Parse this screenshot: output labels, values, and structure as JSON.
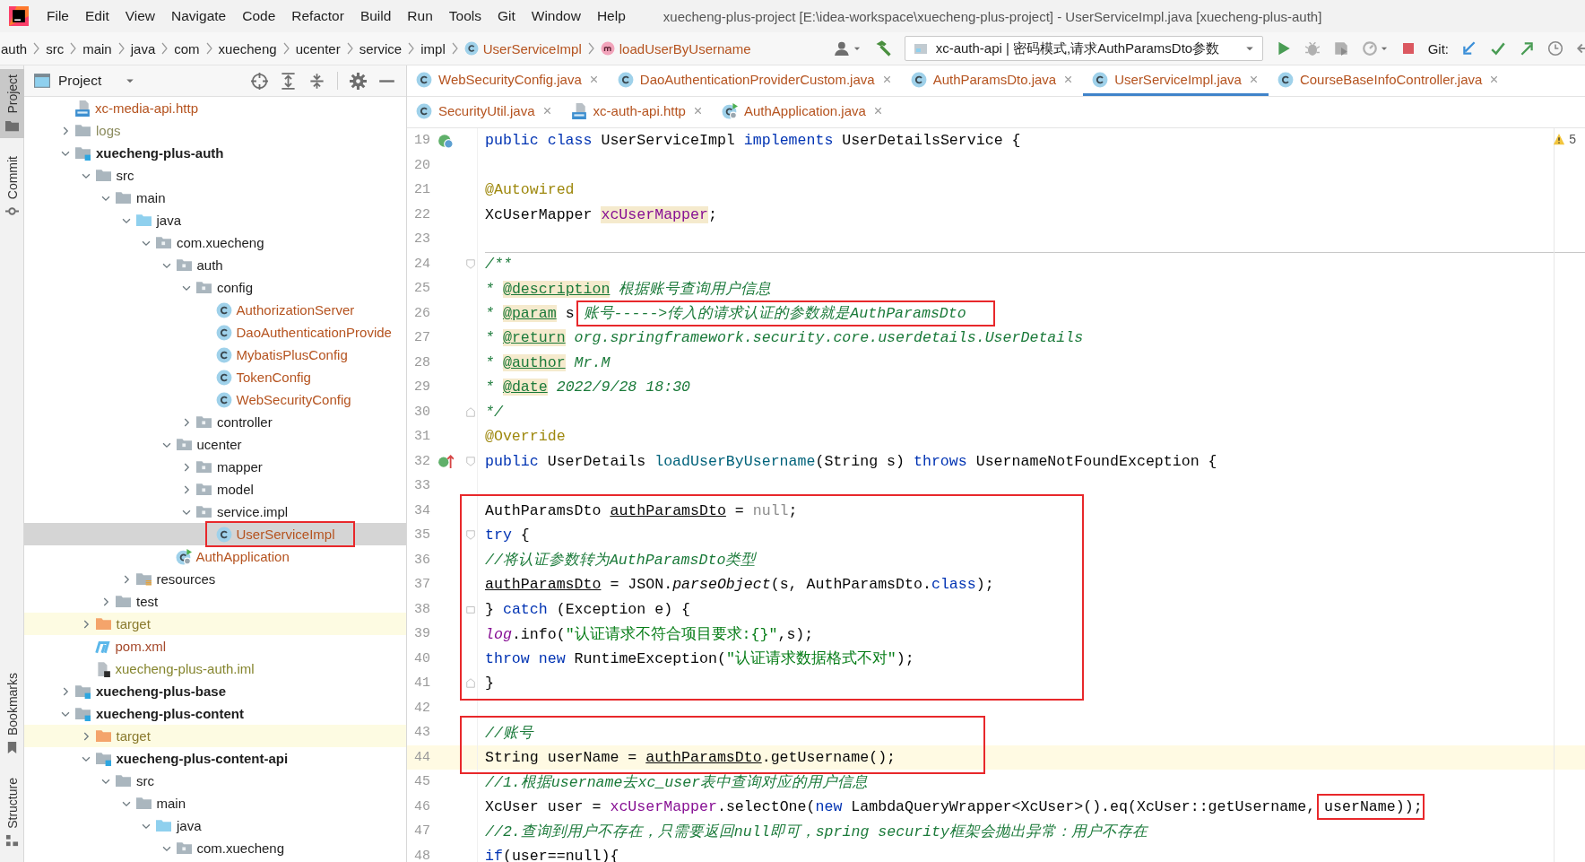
{
  "menu_bar": {
    "items": [
      "File",
      "Edit",
      "View",
      "Navigate",
      "Code",
      "Refactor",
      "Build",
      "Run",
      "Tools",
      "Git",
      "Window",
      "Help"
    ]
  },
  "window_title": "xuecheng-plus-project [E:\\idea-workspace\\xuecheng-plus-project] - UserServiceImpl.java [xuecheng-plus-auth]",
  "breadcrumbs": [
    {
      "label": "auth",
      "kind": "folder"
    },
    {
      "label": "src",
      "kind": "folder"
    },
    {
      "label": "main",
      "kind": "folder"
    },
    {
      "label": "java",
      "kind": "folder"
    },
    {
      "label": "com",
      "kind": "folder"
    },
    {
      "label": "xuecheng",
      "kind": "folder"
    },
    {
      "label": "ucenter",
      "kind": "folder"
    },
    {
      "label": "service",
      "kind": "folder"
    },
    {
      "label": "impl",
      "kind": "folder"
    },
    {
      "label": "UserServiceImpl",
      "kind": "class"
    },
    {
      "label": "loadUserByUsername",
      "kind": "method"
    }
  ],
  "toolbar": {
    "run_configuration": "xc-auth-api | 密码模式,请求AuthParamsDto参数",
    "vcs_label": "Git:"
  },
  "tool_strip": {
    "top": [
      {
        "label": "Project",
        "kind": "project",
        "selected": true
      },
      {
        "label": "Commit",
        "kind": "commit",
        "selected": false
      }
    ],
    "bottom": [
      {
        "label": "Bookmarks",
        "kind": "bookmarks",
        "selected": false
      },
      {
        "label": "Structure",
        "kind": "structure",
        "selected": false
      }
    ]
  },
  "project_panel": {
    "title": "Project",
    "tree": [
      {
        "label": "xc-media-api.http",
        "kind": "http",
        "color": "#b5531f",
        "selected": false
      },
      {
        "label": "logs",
        "kind": "folder",
        "color": "#8a8a5c",
        "expanded": false,
        "selected": false
      },
      {
        "label": "xuecheng-plus-auth",
        "kind": "module",
        "expanded": true,
        "selected": false,
        "children": [
          {
            "label": "src",
            "kind": "folder",
            "expanded": true,
            "selected": false,
            "children": [
              {
                "label": "main",
                "kind": "folder",
                "expanded": true,
                "selected": false,
                "children": [
                  {
                    "label": "java",
                    "kind": "source",
                    "expanded": true,
                    "selected": false,
                    "children": [
                      {
                        "label": "com.xuecheng",
                        "kind": "package",
                        "expanded": true,
                        "selected": false,
                        "children": [
                          {
                            "label": "auth",
                            "kind": "package",
                            "expanded": true,
                            "selected": false,
                            "children": [
                              {
                                "label": "config",
                                "kind": "package",
                                "expanded": true,
                                "selected": false,
                                "children": [
                                  {
                                    "label": "AuthorizationServer",
                                    "kind": "class",
                                    "color": "#b5531f",
                                    "selected": false
                                  },
                                  {
                                    "label": "DaoAuthenticationProvide",
                                    "kind": "class",
                                    "color": "#b5531f",
                                    "selected": false
                                  },
                                  {
                                    "label": "MybatisPlusConfig",
                                    "kind": "class",
                                    "color": "#b5531f",
                                    "selected": false
                                  },
                                  {
                                    "label": "TokenConfig",
                                    "kind": "class",
                                    "color": "#b5531f",
                                    "selected": false
                                  },
                                  {
                                    "label": "WebSecurityConfig",
                                    "kind": "class",
                                    "color": "#b5531f",
                                    "selected": false
                                  }
                                ]
                              },
                              {
                                "label": "controller",
                                "kind": "package",
                                "expanded": false,
                                "selected": false
                              }
                            ]
                          },
                          {
                            "label": "ucenter",
                            "kind": "package",
                            "expanded": true,
                            "selected": false,
                            "children": [
                              {
                                "label": "mapper",
                                "kind": "package",
                                "expanded": false,
                                "selected": false
                              },
                              {
                                "label": "model",
                                "kind": "package",
                                "expanded": false,
                                "selected": false
                              },
                              {
                                "label": "service.impl",
                                "kind": "package",
                                "expanded": true,
                                "selected": false,
                                "children": [
                                  {
                                    "label": "UserServiceImpl",
                                    "kind": "class",
                                    "color": "#b5531f",
                                    "selected": true,
                                    "outlined": true
                                  }
                                ]
                              }
                            ]
                          },
                          {
                            "label": "AuthApplication",
                            "kind": "app",
                            "color": "#b5531f",
                            "selected": false
                          }
                        ]
                      }
                    ]
                  },
                  {
                    "label": "resources",
                    "kind": "resources",
                    "expanded": false,
                    "selected": false
                  }
                ]
              },
              {
                "label": "test",
                "kind": "folder",
                "expanded": false,
                "selected": false
              }
            ]
          },
          {
            "label": "target",
            "kind": "excluded",
            "color": "#8a7a2e",
            "expanded": false,
            "selected": false
          },
          {
            "label": "pom.xml",
            "kind": "maven",
            "color": "#a5482a",
            "selected": false
          },
          {
            "label": "xuecheng-plus-auth.iml",
            "kind": "iml",
            "color": "#85852e",
            "selected": false
          }
        ]
      },
      {
        "label": "xuecheng-plus-base",
        "kind": "module",
        "expanded": false,
        "selected": false
      },
      {
        "label": "xuecheng-plus-content",
        "kind": "module",
        "expanded": true,
        "selected": false,
        "children": [
          {
            "label": "target",
            "kind": "excluded",
            "color": "#8a7a2e",
            "expanded": false,
            "selected": false
          },
          {
            "label": "xuecheng-plus-content-api",
            "kind": "module",
            "expanded": true,
            "selected": false,
            "children": [
              {
                "label": "src",
                "kind": "folder",
                "expanded": true,
                "selected": false,
                "children": [
                  {
                    "label": "main",
                    "kind": "folder",
                    "expanded": true,
                    "selected": false,
                    "children": [
                      {
                        "label": "java",
                        "kind": "source",
                        "expanded": true,
                        "selected": false,
                        "children": [
                          {
                            "label": "com.xuecheng",
                            "kind": "package",
                            "expanded": true,
                            "selected": false
                          }
                        ]
                      }
                    ]
                  }
                ]
              }
            ]
          }
        ]
      }
    ]
  },
  "editor": {
    "tab_rows": [
      [
        {
          "label": "WebSecurityConfig.java",
          "kind": "class",
          "selected": false
        },
        {
          "label": "DaoAuthenticationProviderCustom.java",
          "kind": "class",
          "selected": false
        },
        {
          "label": "AuthParamsDto.java",
          "kind": "class",
          "selected": false
        },
        {
          "label": "UserServiceImpl.java",
          "kind": "class",
          "selected": true
        },
        {
          "label": "CourseBaseInfoController.java",
          "kind": "class",
          "selected": false
        }
      ],
      [
        {
          "label": "SecurityUtil.java",
          "kind": "class",
          "selected": false
        },
        {
          "label": "xc-auth-api.http",
          "kind": "http",
          "selected": false
        },
        {
          "label": "AuthApplication.java",
          "kind": "app",
          "selected": false
        }
      ]
    ],
    "warnings": "5",
    "lines": [
      {
        "kind": "line",
        "number": "19",
        "implements_marker": true,
        "tokens": [
          {
            "kind": "kw",
            "text": "public"
          },
          {
            "kind": "kw",
            "text": " class"
          },
          {
            "kind": "plain",
            "text": " UserServiceImpl "
          },
          {
            "kind": "kw",
            "text": "implements"
          },
          {
            "kind": "plain",
            "text": " UserDetailsService {"
          }
        ]
      },
      {
        "kind": "line",
        "number": "20"
      },
      {
        "kind": "line",
        "number": "21",
        "tokens": [
          {
            "kind": "anno",
            "text": "    @Autowired"
          }
        ]
      },
      {
        "kind": "line",
        "number": "22",
        "tokens": [
          {
            "kind": "plain",
            "text": "    XcUserMapper "
          },
          {
            "kind": "field-usage",
            "text": "xcUserMapper"
          },
          {
            "kind": "plain",
            "text": ";"
          }
        ]
      },
      {
        "kind": "line",
        "number": "23"
      },
      {
        "kind": "line",
        "number": "24",
        "fold_start": true,
        "separator_above": true,
        "tokens": [
          {
            "kind": "doc",
            "text": "    /**"
          }
        ]
      },
      {
        "kind": "line",
        "number": "25",
        "tokens": [
          {
            "kind": "doc",
            "text": "     * "
          },
          {
            "kind": "doctag",
            "text": "@description"
          },
          {
            "kind": "doc",
            "text": " 根据账号查询用户信息"
          }
        ]
      },
      {
        "kind": "line",
        "number": "26",
        "tokens": [
          {
            "kind": "doc",
            "text": "     * "
          },
          {
            "kind": "doctag",
            "text": "@param"
          },
          {
            "kind": "plain",
            "text": " s "
          },
          {
            "kind": "doc",
            "text": "账号----->传入的请求认证的参数就是AuthParamsDto",
            "outlined": true
          }
        ]
      },
      {
        "kind": "line",
        "number": "27",
        "tokens": [
          {
            "kind": "doc",
            "text": "     * "
          },
          {
            "kind": "doctag",
            "text": "@return"
          },
          {
            "kind": "doc",
            "text": " org.springframework.security.core.userdetails.UserDetails"
          }
        ]
      },
      {
        "kind": "line",
        "number": "28",
        "tokens": [
          {
            "kind": "doc",
            "text": "     * "
          },
          {
            "kind": "doctag",
            "text": "@author"
          },
          {
            "kind": "doc",
            "text": " Mr.M"
          }
        ]
      },
      {
        "kind": "line",
        "number": "29",
        "tokens": [
          {
            "kind": "doc",
            "text": "     * "
          },
          {
            "kind": "doctag",
            "text": "@date"
          },
          {
            "kind": "doc",
            "text": " 2022/9/28 18:30"
          }
        ]
      },
      {
        "kind": "line",
        "number": "30",
        "fold_end": true,
        "tokens": [
          {
            "kind": "doc",
            "text": "     */"
          }
        ]
      },
      {
        "kind": "line",
        "number": "31",
        "tokens": [
          {
            "kind": "anno",
            "text": "    @Override"
          }
        ]
      },
      {
        "kind": "line",
        "number": "32",
        "override_marker": true,
        "fold_start": true,
        "tokens": [
          {
            "kind": "kw",
            "text": "    public"
          },
          {
            "kind": "plain",
            "text": " UserDetails "
          },
          {
            "kind": "method",
            "text": "loadUserByUsername"
          },
          {
            "kind": "plain",
            "text": "(String s) "
          },
          {
            "kind": "kw",
            "text": "throws"
          },
          {
            "kind": "plain",
            "text": " UsernameNotFoundException {"
          }
        ]
      },
      {
        "kind": "line",
        "number": "33"
      },
      {
        "kind": "boxed_group",
        "lines": [
          {
            "kind": "line",
            "number": "34",
            "tokens": [
              {
                "kind": "plain",
                "text": "        AuthParamsDto "
              },
              {
                "kind": "var",
                "text": "authParamsDto"
              },
              {
                "kind": "plain",
                "text": " = "
              },
              {
                "kind": "null",
                "text": "null"
              },
              {
                "kind": "plain",
                "text": ";"
              }
            ]
          },
          {
            "kind": "line",
            "number": "35",
            "fold_start": true,
            "tokens": [
              {
                "kind": "kw",
                "text": "        try"
              },
              {
                "kind": "plain",
                "text": " {"
              }
            ]
          },
          {
            "kind": "line",
            "number": "36",
            "tokens": [
              {
                "kind": "comment",
                "text": "            //将认证参数转为AuthParamsDto类型"
              }
            ]
          },
          {
            "kind": "line",
            "number": "37",
            "tokens": [
              {
                "kind": "var",
                "text": "            authParamsDto"
              },
              {
                "kind": "plain",
                "text": " = JSON."
              },
              {
                "kind": "static",
                "text": "parseObject"
              },
              {
                "kind": "plain",
                "text": "(s, AuthParamsDto."
              },
              {
                "kind": "kw",
                "text": "class"
              },
              {
                "kind": "plain",
                "text": ");"
              }
            ]
          },
          {
            "kind": "line",
            "number": "38",
            "fold_start": true,
            "fold_end": true,
            "tokens": [
              {
                "kind": "plain",
                "text": "        } "
              },
              {
                "kind": "kw",
                "text": "catch"
              },
              {
                "kind": "plain",
                "text": " (Exception e) {"
              }
            ]
          },
          {
            "kind": "line",
            "number": "39",
            "tokens": [
              {
                "kind": "static-field",
                "text": "            log"
              },
              {
                "kind": "plain",
                "text": ".info("
              },
              {
                "kind": "str",
                "text": "\"认证请求不符合项目要求:{}\""
              },
              {
                "kind": "plain",
                "text": ",s);"
              }
            ]
          },
          {
            "kind": "line",
            "number": "40",
            "tokens": [
              {
                "kind": "kw",
                "text": "            throw"
              },
              {
                "kind": "kw",
                "text": " new"
              },
              {
                "kind": "plain",
                "text": " RuntimeException("
              },
              {
                "kind": "str",
                "text": "\"认证请求数据格式不对\""
              },
              {
                "kind": "plain",
                "text": ");"
              }
            ]
          },
          {
            "kind": "line",
            "number": "41",
            "fold_end": true,
            "tokens": [
              {
                "kind": "plain",
                "text": "        }"
              }
            ]
          }
        ]
      },
      {
        "kind": "line",
        "number": "42"
      },
      {
        "kind": "boxed_group",
        "lines": [
          {
            "kind": "line",
            "number": "43",
            "tokens": [
              {
                "kind": "comment",
                "text": "        //账号"
              }
            ]
          },
          {
            "kind": "line",
            "number": "44",
            "current": true,
            "tokens": [
              {
                "kind": "plain",
                "text": "        String userName = "
              },
              {
                "kind": "var",
                "text": "authParamsDto"
              },
              {
                "kind": "plain",
                "text": ".getUsername();"
              }
            ]
          }
        ]
      },
      {
        "kind": "line",
        "number": "45",
        "tokens": [
          {
            "kind": "comment",
            "text": "        //1.根据username去xc_user表中查询对应的用户信息"
          }
        ]
      },
      {
        "kind": "line",
        "number": "46",
        "tokens": [
          {
            "kind": "plain",
            "text": "        XcUser user = "
          },
          {
            "kind": "field",
            "text": "xcUserMapper"
          },
          {
            "kind": "plain",
            "text": ".selectOne("
          },
          {
            "kind": "kw",
            "text": "new"
          },
          {
            "kind": "plain",
            "text": " LambdaQueryWrapper<XcUser>().eq(XcUser::getUsername, "
          },
          {
            "kind": "plain",
            "text": "userName",
            "outlined": true
          },
          {
            "kind": "plain",
            "text": "));"
          }
        ]
      },
      {
        "kind": "line",
        "number": "47",
        "tokens": [
          {
            "kind": "comment",
            "text": "        //2.查询到用户不存在，只需要返回null即可，spring security框架会抛出异常：用户不存在"
          }
        ]
      },
      {
        "kind": "line",
        "number": "48",
        "tokens": [
          {
            "kind": "kw",
            "text": "        if"
          },
          {
            "kind": "plain",
            "text": "(user==null){"
          }
        ]
      }
    ]
  }
}
